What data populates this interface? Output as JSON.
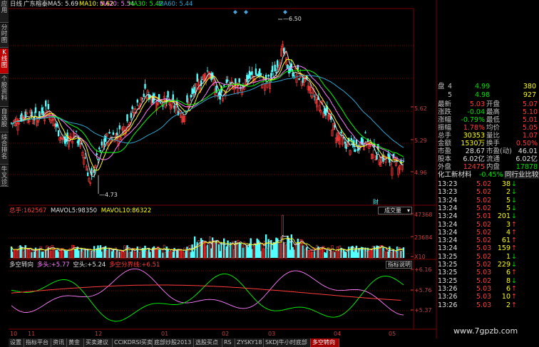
{
  "colors": {
    "up": "#ff3c3c",
    "down": "#54ffff",
    "ma5": "#e0e0e0",
    "ma10": "#ffff00",
    "ma20": "#ff80ff",
    "ma30": "#00ff00",
    "ma60": "#2ea6d0",
    "grid": "#7a0000",
    "axis_text": "#c04040"
  },
  "header": {
    "period": "日线",
    "stock": "广东榕泰",
    "ma": [
      {
        "label": "MA5:",
        "value": "5.69"
      },
      {
        "label": "MA10:",
        "value": "5.62"
      },
      {
        "label": "MA20:",
        "value": "5.54"
      },
      {
        "label": "MA30:",
        "value": "5.42"
      },
      {
        "label": "MA60:",
        "value": "5.44"
      }
    ]
  },
  "left_tabs": [
    "应用",
    "分时图",
    "K线图",
    "个股资料",
    "自选股",
    "综合排名",
    "牛叉诊断"
  ],
  "price_axis": [
    "5.62",
    "5.29",
    "4.96"
  ],
  "annotations": {
    "high": "6.50",
    "low": "4.73",
    "cai": "财"
  },
  "volume": {
    "title": "总手:",
    "total": "162567",
    "mavol5_label": "MAVOL5:",
    "mavol5": "98350",
    "mavol10_label": "MAVOL10:",
    "mavol10": "86322",
    "button": "成交量",
    "axis": [
      "47368",
      "23684",
      "X10"
    ]
  },
  "indicator": {
    "title": "多空转向",
    "long_label": "多头:",
    "long_value": "+5.77",
    "short_label": "空头:",
    "short_value": "+5.24",
    "line_label": "多空分界线:",
    "line_value": "+6.51",
    "button": "指标说明",
    "axis": [
      "+6.16",
      "+5.76",
      "+5.37"
    ]
  },
  "date_axis": [
    "10",
    "11",
    "12",
    "01",
    "02",
    "03",
    "04",
    "05"
  ],
  "quote_top": [
    {
      "k": "盘",
      "n": "4",
      "p": "4.99",
      "v": "380"
    },
    {
      "k": "",
      "n": "5",
      "p": "4.98",
      "v": "927"
    }
  ],
  "quote_stats": [
    {
      "k1": "最新",
      "v1": "5.03",
      "k2": "开盘",
      "v2": "5.07"
    },
    {
      "k1": "涨跌",
      "v1": "-0.04",
      "k2": "最高",
      "v2": "5.10"
    },
    {
      "k1": "涨幅",
      "v1": "-0.79%",
      "k2": "最低",
      "v2": "5.01"
    },
    {
      "k1": "振幅",
      "v1": "1.78%",
      "k2": "均价",
      "v2": "5.05"
    },
    {
      "k1": "总手",
      "v1": "30353",
      "k2": "量比",
      "v2": "1.07"
    },
    {
      "k1": "金额",
      "v1": "1530万",
      "k2": "换手",
      "v2": "0.50%"
    },
    {
      "k1": "市盈",
      "v1": "28.67",
      "k2": "市盈(动)",
      "v2": "46.01"
    },
    {
      "k1": "股本",
      "v1": "6.02亿",
      "k2": "流通",
      "v2": "6.02亿"
    },
    {
      "k1": "外盘",
      "v1": "12475",
      "k2": "内盘",
      "v2": "17878"
    }
  ],
  "sector": {
    "name": "化工新材料",
    "change": "-0.45%",
    "compare": "同行业比较"
  },
  "ticks": [
    {
      "t": "13:23",
      "p": "5.02",
      "v": "38",
      "d": "down"
    },
    {
      "t": "13:23",
      "p": "5.02",
      "v": "2",
      "d": "down"
    },
    {
      "t": "13:24",
      "p": "5.02",
      "v": "5",
      "d": "down"
    },
    {
      "t": "13:24",
      "p": "5.02",
      "v": "5",
      "d": "down"
    },
    {
      "t": "13:24",
      "p": "5.01",
      "v": "201",
      "d": "down"
    },
    {
      "t": "13:24",
      "p": "5.02",
      "v": "3",
      "d": "up"
    },
    {
      "t": "13:24",
      "p": "5.02",
      "v": "4",
      "d": "up"
    },
    {
      "t": "13:24",
      "p": "5.02",
      "v": "61",
      "d": "up"
    },
    {
      "t": "13:24",
      "p": "5.03",
      "v": "159",
      "d": "up"
    },
    {
      "t": "13:25",
      "p": "5.02",
      "v": "1",
      "d": "down"
    },
    {
      "t": "13:25",
      "p": "5.02",
      "v": "229",
      "d": "down"
    },
    {
      "t": "13:25",
      "p": "5.03",
      "v": "6",
      "d": "up"
    },
    {
      "t": "13:25",
      "p": "5.02",
      "v": "8",
      "d": "down"
    },
    {
      "t": "13:26",
      "p": "5.03",
      "v": "6",
      "d": "up"
    },
    {
      "t": "13:26",
      "p": "5.03",
      "v": "10",
      "d": "up"
    },
    {
      "t": "13:26",
      "p": "5.03",
      "v": "2",
      "d": "up"
    }
  ],
  "bottom_tabs": [
    "设置",
    "指标平台",
    "资讯",
    "黄金",
    "买卖建议",
    "CCIKDRSI买卖",
    "底部炒股2013",
    "选股买点",
    "RS",
    "ZYSKY18",
    "SKDJ牛小时底部",
    "多空转向"
  ],
  "watermark": "www.7gpzb.com"
}
